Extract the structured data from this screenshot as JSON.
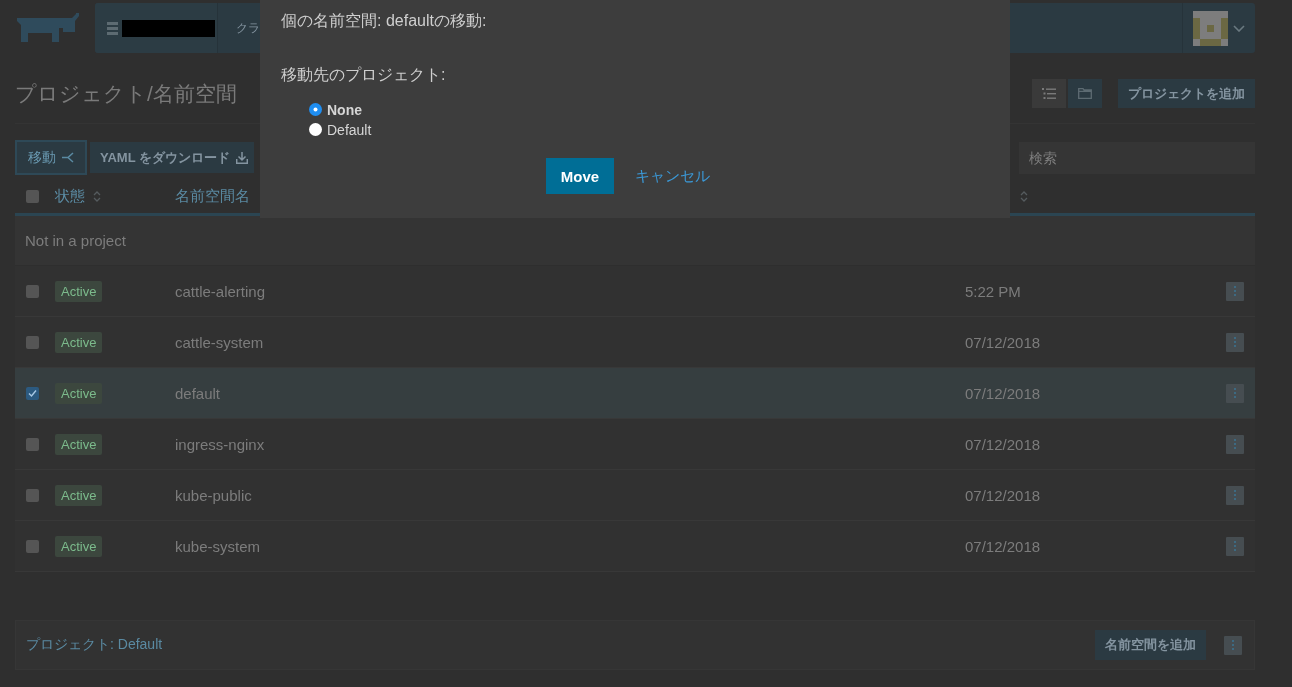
{
  "header": {
    "nav_item": "クラ"
  },
  "page": {
    "title": "プロジェクト/名前空間",
    "view_modes": [
      {
        "kind": "list",
        "selected": true
      },
      {
        "kind": "folder",
        "selected": false
      }
    ],
    "add_project": "プロジェクトを追加"
  },
  "toolbar": {
    "actions": [
      {
        "kind": "move",
        "label": "移動"
      },
      {
        "kind": "download",
        "label": "YAML をダウンロード"
      }
    ],
    "search": {
      "placeholder": "検索"
    }
  },
  "table": {
    "select_all": {
      "checked": false
    },
    "columns": [
      {
        "label": "状態",
        "sortable": true
      },
      {
        "label": "名前空間名",
        "sortable": false
      },
      {
        "sortable": true
      }
    ]
  },
  "unassigned_group": {
    "title": "Not in a project",
    "rows": [
      {
        "checked": false,
        "status": "Active",
        "name": "cattle-alerting",
        "created": "5:22 PM"
      },
      {
        "checked": false,
        "status": "Active",
        "name": "cattle-system",
        "created": "07/12/2018"
      },
      {
        "checked": true,
        "status": "Active",
        "name": "default",
        "created": "07/12/2018"
      },
      {
        "checked": false,
        "status": "Active",
        "name": "ingress-nginx",
        "created": "07/12/2018"
      },
      {
        "checked": false,
        "status": "Active",
        "name": "kube-public",
        "created": "07/12/2018"
      },
      {
        "checked": false,
        "status": "Active",
        "name": "kube-system",
        "created": "07/12/2018"
      }
    ]
  },
  "project_group": {
    "title": "プロジェクト: Default",
    "add_button": "名前空間を追加"
  },
  "modal": {
    "title": "個の名前空間: defaultの移動:",
    "target_label": "移動先のプロジェクト:",
    "options": [
      {
        "label": "None",
        "selected": true
      },
      {
        "label": "Default",
        "selected": false
      }
    ],
    "confirm": "Move",
    "cancel": "キャンセル"
  }
}
